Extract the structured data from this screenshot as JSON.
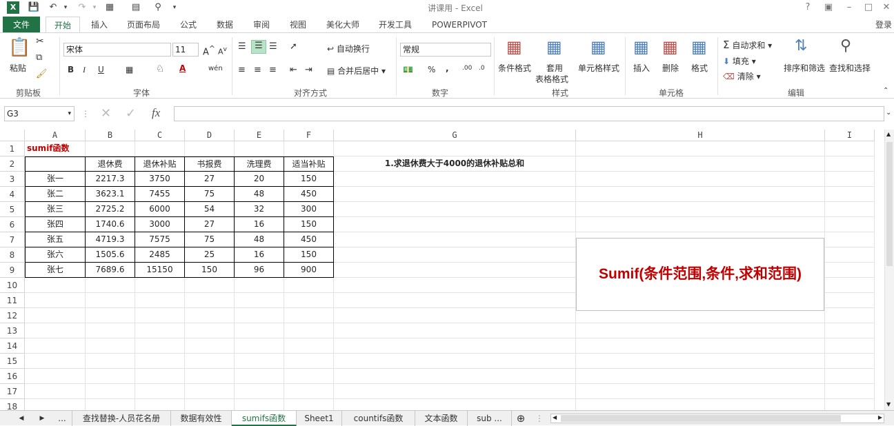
{
  "window": {
    "title": "讲课用 - Excel",
    "login": "登录"
  },
  "tabs": [
    "文件",
    "开始",
    "插入",
    "页面布局",
    "公式",
    "数据",
    "审阅",
    "视图",
    "美化大师",
    "开发工具",
    "POWERPIVOT"
  ],
  "ribbon": {
    "clipboard": {
      "paste": "粘贴",
      "label": "剪贴板"
    },
    "font": {
      "name": "宋体",
      "size": "11",
      "label": "字体",
      "bold": "B",
      "italic": "I",
      "underline": "U",
      "phonetic": "wén",
      "fontcolor": "A"
    },
    "align": {
      "wrap": "自动换行",
      "merge": "合并后居中",
      "label": "对齐方式"
    },
    "number": {
      "format": "常规",
      "label": "数字",
      "percent": "%",
      "comma": ","
    },
    "styles": {
      "cond": "条件格式",
      "table1": "套用",
      "table2": "表格格式",
      "cell": "单元格样式",
      "label": "样式"
    },
    "cells": {
      "insert": "插入",
      "delete": "删除",
      "format": "格式",
      "label": "单元格"
    },
    "edit": {
      "autosum": "自动求和",
      "fill": "填充",
      "clear": "清除",
      "sort": "排序和筛选",
      "find": "查找和选择",
      "label": "编辑"
    }
  },
  "formula_bar": {
    "name_box": "G3",
    "fx": "fx",
    "value": ""
  },
  "columns": [
    "A",
    "B",
    "C",
    "D",
    "E",
    "F",
    "G",
    "H",
    "I"
  ],
  "rows": [
    "1",
    "2",
    "3",
    "4",
    "5",
    "6",
    "7",
    "8",
    "9",
    "10",
    "11",
    "12",
    "13",
    "14",
    "15",
    "16",
    "17",
    "18"
  ],
  "sheet": {
    "a1": "sumif函数",
    "headers": [
      "退休费",
      "退休补贴",
      "书报费",
      "洗理费",
      "适当补贴"
    ],
    "records": [
      [
        "张一",
        "2217.3",
        "3750",
        "27",
        "20",
        "150"
      ],
      [
        "张二",
        "3623.1",
        "7455",
        "75",
        "48",
        "450"
      ],
      [
        "张三",
        "2725.2",
        "6000",
        "54",
        "32",
        "300"
      ],
      [
        "张四",
        "1740.6",
        "3000",
        "27",
        "16",
        "150"
      ],
      [
        "张五",
        "4719.3",
        "7575",
        "75",
        "48",
        "450"
      ],
      [
        "张六",
        "1505.6",
        "2485",
        "25",
        "16",
        "150"
      ],
      [
        "张七",
        "7689.6",
        "15150",
        "150",
        "96",
        "900"
      ]
    ],
    "question": "1.求退休费大于4000的退休补贴总和",
    "note": "Sumif(条件范围,条件,求和范围)"
  },
  "sheet_tabs": [
    "...",
    "查找替换-人员花名册",
    "数据有效性",
    "sumifs函数",
    "Sheet1",
    "countifs函数",
    "文本函数",
    "sub ..."
  ],
  "colors": {
    "accent": "#217346",
    "red": "#c00000"
  }
}
